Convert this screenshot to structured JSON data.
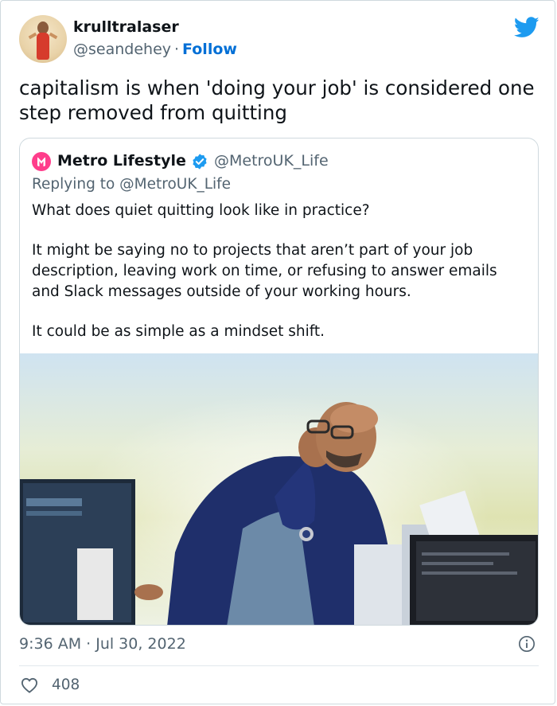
{
  "tweet": {
    "author_name": "krulltralaser",
    "author_handle": "@seandehey",
    "separator": "·",
    "follow_label": "Follow",
    "text": "capitalism is when 'doing your job' is considered one step removed from quitting",
    "timestamp": "9:36 AM · Jul 30, 2022",
    "likes": "408"
  },
  "quoted": {
    "name": "Metro Lifestyle",
    "handle": "@MetroUK_Life",
    "reply_to": "Replying to @MetroUK_Life",
    "paragraphs": [
      "What does quiet quitting look like in practice?",
      "It might be saying no to projects that aren’t part of your job description, leaving work on time, or refusing to answer emails and Slack messages outside of your working hours.",
      "It could be as simple as a mindset shift."
    ]
  },
  "icons": {
    "brand": "twitter-bird-icon",
    "verified": "verified-badge-icon",
    "info": "info-icon",
    "like": "heart-icon"
  },
  "colors": {
    "twitter_blue": "#1d9bf0",
    "follow_link": "#006fd6",
    "secondary_text": "#536471",
    "metro_pink": "#ff3d8b"
  }
}
